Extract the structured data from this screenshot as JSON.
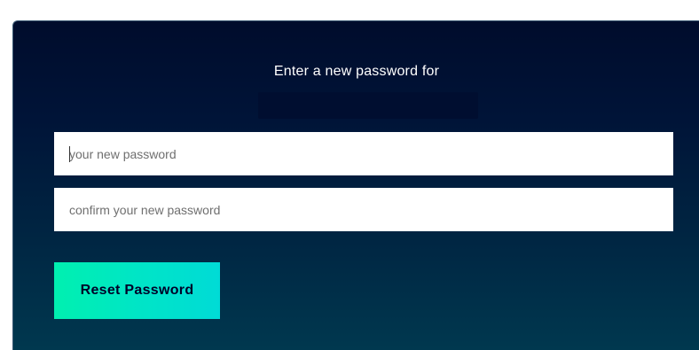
{
  "form": {
    "title": "Enter a new password for",
    "username": "",
    "new_password": {
      "value": "",
      "placeholder": "your new password"
    },
    "confirm_password": {
      "value": "",
      "placeholder": "confirm your new password"
    },
    "submit_label": "Reset Password"
  },
  "colors": {
    "panel_top": "#000c2c",
    "panel_bottom": "#00384f",
    "button_start": "#00f0b0",
    "button_end": "#00dbd6",
    "button_text": "#000028"
  }
}
